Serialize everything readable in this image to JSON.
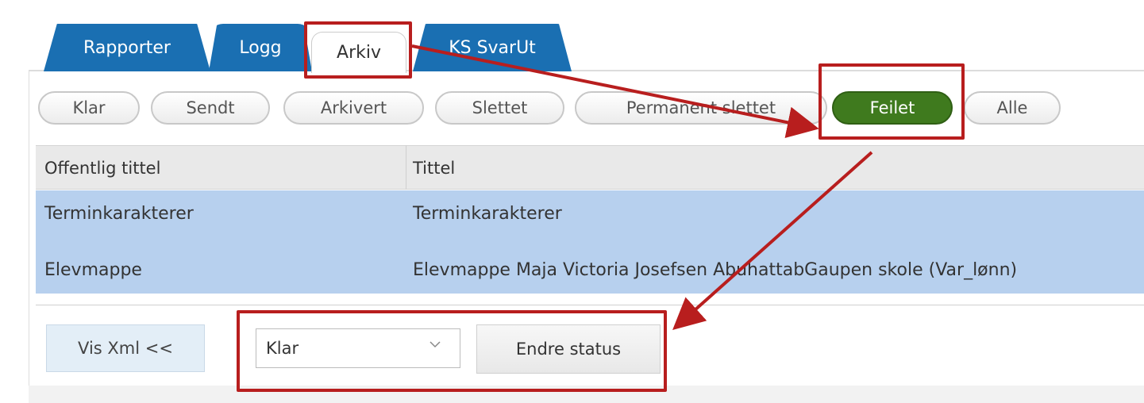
{
  "tabs": [
    {
      "label": "Rapporter"
    },
    {
      "label": "Logg"
    },
    {
      "label": "Arkiv"
    },
    {
      "label": "KS SvarUt"
    }
  ],
  "active_tab": "Arkiv",
  "filters": [
    {
      "label": "Klar"
    },
    {
      "label": "Sendt"
    },
    {
      "label": "Arkivert"
    },
    {
      "label": "Slettet"
    },
    {
      "label": "Permanent slettet"
    },
    {
      "label": "Feilet"
    },
    {
      "label": "Alle"
    }
  ],
  "active_filter": "Feilet",
  "table": {
    "columns": [
      "Offentlig tittel",
      "Tittel"
    ],
    "rows": [
      [
        "Terminkarakterer",
        "Terminkarakterer"
      ],
      [
        "Elevmappe",
        "Elevmappe Maja Victoria Josefsen AbuhattabGaupen skole (Var_lønn)"
      ]
    ]
  },
  "footer": {
    "vis_xml_label": "Vis Xml <<",
    "status_select_value": "Klar",
    "change_status_label": "Endre status"
  },
  "colors": {
    "tab_blue": "#1a6fb2",
    "active_filter_green": "#3f7a1e",
    "row_selected": "#b7d0ee",
    "annotation_red": "#b81e1e"
  },
  "icons": {
    "select_chevron": "chevron-down-icon"
  }
}
